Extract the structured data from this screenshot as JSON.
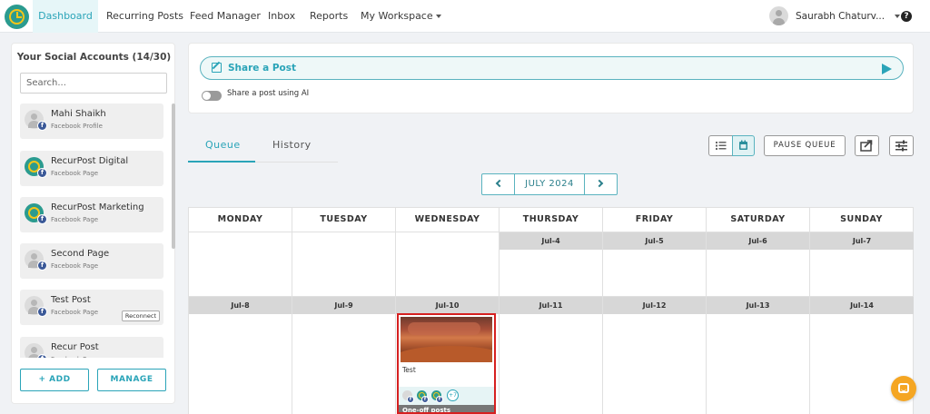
{
  "nav": {
    "items": [
      "Dashboard",
      "Recurring Posts",
      "Feed Manager",
      "Inbox",
      "Reports",
      "My Workspace"
    ],
    "user_name": "Saurabh Chaturv..."
  },
  "left_panel": {
    "title": "Your Social Accounts (14/30)",
    "search_placeholder": "Search...",
    "accounts": [
      {
        "name": "Mahi Shaikh",
        "type": "Facebook Profile"
      },
      {
        "name": "RecurPost Digital",
        "type": "Facebook Page"
      },
      {
        "name": "RecurPost Marketing",
        "type": "Facebook Page"
      },
      {
        "name": "Second Page",
        "type": "Facebook Page"
      },
      {
        "name": "Test Post",
        "type": "Facebook Page",
        "action": "Reconnect"
      },
      {
        "name": "Recur Post",
        "type": "Facebook Page"
      }
    ],
    "add_label": "+ ADD",
    "manage_label": "MANAGE"
  },
  "share": {
    "label": "Share a Post",
    "ai_toggle_label": "Share a post using AI"
  },
  "tabs": [
    "Queue",
    "History"
  ],
  "toolbar": {
    "pause_label": "PAUSE QUEUE"
  },
  "calendar": {
    "month": "JULY 2024",
    "days": [
      "MONDAY",
      "TUESDAY",
      "WEDNESDAY",
      "THURSDAY",
      "FRIDAY",
      "SATURDAY",
      "SUNDAY"
    ],
    "week1": [
      "",
      "",
      "",
      "Jul-4",
      "Jul-5",
      "Jul-6",
      "Jul-7"
    ],
    "week2": [
      "Jul-8",
      "Jul-9",
      "Jul-10",
      "Jul-11",
      "Jul-12",
      "Jul-13",
      "Jul-14"
    ],
    "post": {
      "text": "Test",
      "more": "+7",
      "category": "One-off posts"
    }
  },
  "colors": {
    "accent": "#2aa4b8",
    "date_bar": "#d7d7d7",
    "highlight": "#d62020",
    "chat": "#f5a623"
  },
  "icons": [
    "recurpost-logo-icon",
    "user-avatar-icon",
    "help-icon",
    "edit-icon",
    "send-icon",
    "list-view-icon",
    "calendar-view-icon",
    "export-icon",
    "settings-sliders-icon",
    "chevron-left-icon",
    "chevron-right-icon",
    "facebook-icon",
    "chat-icon"
  ]
}
